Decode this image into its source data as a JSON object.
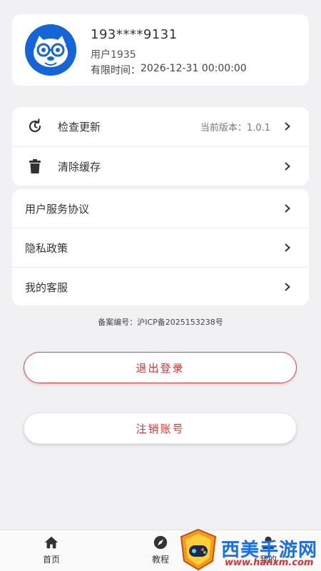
{
  "profile": {
    "phone": "193****9131",
    "username": "用户1935",
    "expire_label": "有限时间：",
    "expire_value": "2026-12-31 00:00:00"
  },
  "settings": {
    "check_update": {
      "label": "检查更新",
      "value": "当前版本：1.0.1",
      "icon": "refresh-icon"
    },
    "clear_cache": {
      "label": "清除缓存",
      "icon": "trash-icon"
    }
  },
  "links": [
    {
      "label": "用户服务协议"
    },
    {
      "label": "隐私政策"
    },
    {
      "label": "我的客服"
    }
  ],
  "icp": "备案编号：沪ICP备2025153238号",
  "buttons": {
    "logout": "退出登录",
    "cancel_account": "注销账号"
  },
  "tabs": [
    {
      "label": "首页",
      "icon": "home-icon"
    },
    {
      "label": "教程",
      "icon": "compass-icon"
    },
    {
      "label": "我的",
      "icon": "user-icon"
    }
  ],
  "watermark": {
    "title": "西美手游网",
    "url": "www.hanxm.com"
  },
  "colors": {
    "accent_red": "#d03a3a",
    "avatar_blue": "#1565d8",
    "background": "#f1f1f4"
  }
}
